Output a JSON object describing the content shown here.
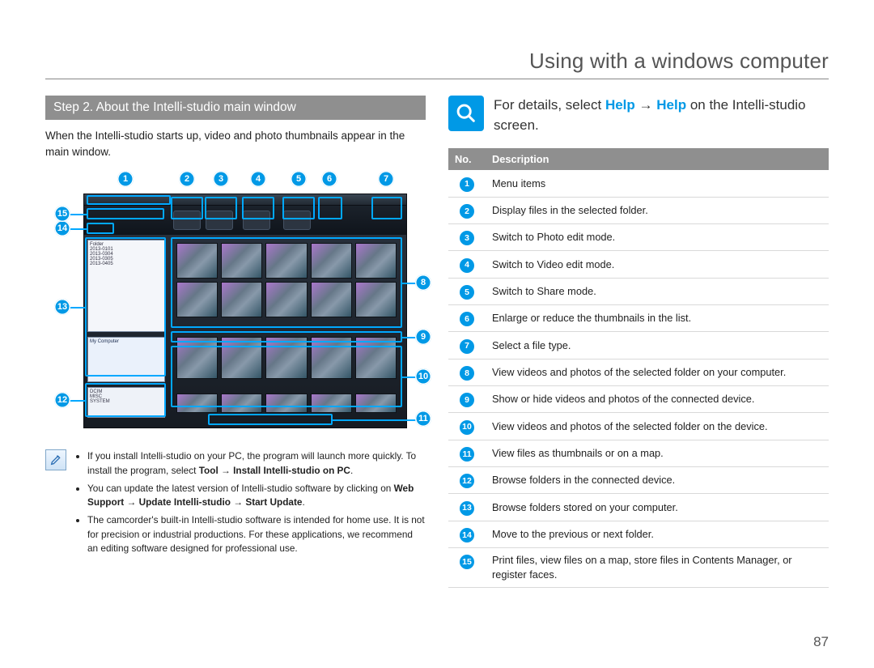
{
  "header": {
    "title": "Using with a windows computer"
  },
  "left": {
    "step_bar": "Step 2. About the Intelli-studio main window",
    "intro": "When the Intelli-studio starts up, video and photo thumbnails appear in the main window.",
    "note": {
      "items": [
        {
          "pre": "If you install Intelli-studio on your PC, the program will launch more quickly. To install the program, select ",
          "bold1": "Tool",
          "sep1": " → ",
          "bold2": "Install Intelli-studio on PC",
          "post": "."
        },
        {
          "pre": "You can update the latest version of Intelli-studio software by clicking on ",
          "bold1": "Web Support",
          "sep1": "  → ",
          "bold2": "Update Intelli-studio",
          "sep2": " → ",
          "bold3": "Start Update",
          "post": "."
        },
        {
          "plain": "The camcorder's built-in Intelli-studio software is intended for home use. It is not for precision or industrial productions. For these applications, we recommend an editing software designed for professional use."
        }
      ]
    },
    "callouts": [
      "1",
      "2",
      "3",
      "4",
      "5",
      "6",
      "7",
      "8",
      "9",
      "10",
      "11",
      "12",
      "13",
      "14",
      "15"
    ]
  },
  "right": {
    "help_pre": "For details, select ",
    "help_h1": "Help",
    "help_arrow": " → ",
    "help_h2": "Help",
    "help_post": " on the Intelli-studio screen.",
    "table": {
      "head_no": "No.",
      "head_desc": "Description",
      "rows": [
        {
          "n": "1",
          "d": "Menu items"
        },
        {
          "n": "2",
          "d": "Display files in the selected folder."
        },
        {
          "n": "3",
          "d": "Switch to Photo edit mode."
        },
        {
          "n": "4",
          "d": "Switch to Video edit mode."
        },
        {
          "n": "5",
          "d": "Switch to Share mode."
        },
        {
          "n": "6",
          "d": "Enlarge or reduce the thumbnails in the list."
        },
        {
          "n": "7",
          "d": "Select a file type."
        },
        {
          "n": "8",
          "d": "View videos and photos of the selected folder on your computer."
        },
        {
          "n": "9",
          "d": "Show or hide videos and photos of the connected device."
        },
        {
          "n": "10",
          "d": "View videos and photos of the selected folder on the device."
        },
        {
          "n": "11",
          "d": "View files as thumbnails or on a map."
        },
        {
          "n": "12",
          "d": "Browse folders in the connected device."
        },
        {
          "n": "13",
          "d": "Browse folders stored on your computer."
        },
        {
          "n": "14",
          "d": "Move to the previous or next folder."
        },
        {
          "n": "15",
          "d": "Print files, view files on a map, store files in Contents Manager, or register faces."
        }
      ]
    }
  },
  "page_number": "87"
}
